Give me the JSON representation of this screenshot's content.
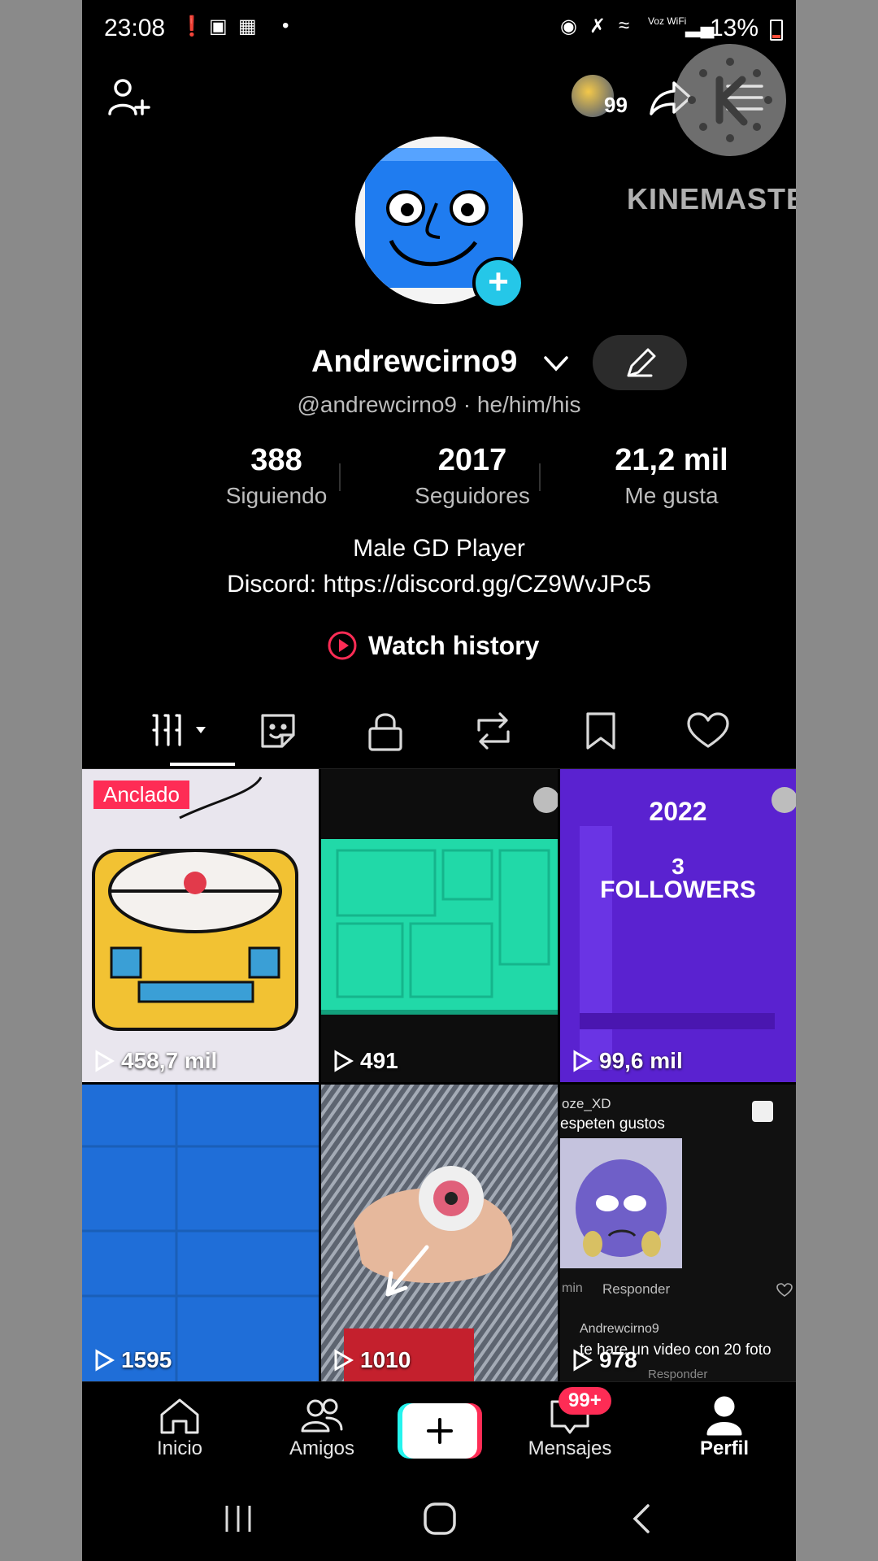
{
  "status_bar": {
    "time": "23:08",
    "battery": "13%",
    "wifi_label": "Voz WiFi"
  },
  "header": {
    "notif_count": "99"
  },
  "watermark": {
    "text": "KINEMASTER"
  },
  "profile": {
    "display_name": "Andrewcirno9",
    "handle": "@andrewcirno9 · he/him/his",
    "stats": [
      {
        "value": "388",
        "label": "Siguiendo"
      },
      {
        "value": "2017",
        "label": "Seguidores"
      },
      {
        "value": "21,2 mil",
        "label": "Me gusta"
      }
    ],
    "bio_line1": "Male GD Player",
    "bio_line2": "Discord: https://discord.gg/CZ9WvJPc5",
    "watch_history": "Watch history"
  },
  "tabs": [
    "videos-grid",
    "stickers",
    "private",
    "reposts",
    "favorites",
    "liked"
  ],
  "grid": {
    "pinned_label": "Anclado",
    "videos": [
      {
        "views": "458,7 mil"
      },
      {
        "views": "491"
      },
      {
        "views": "99,6 mil",
        "overlay_top": "2022",
        "overlay_mid": "3",
        "overlay_bottom": "FOLLOWERS"
      },
      {
        "views": "1595"
      },
      {
        "views": "1010"
      },
      {
        "views": "978",
        "c1_user": "oze_XD",
        "c1_text": "espeten gustos",
        "c1_time": "min",
        "c1_reply": "Responder",
        "c2_user": "Andrewcirno9",
        "c2_text": "te hare un video con 20 foto",
        "c2_reply": "Responder"
      }
    ]
  },
  "bottom_nav": {
    "home": "Inicio",
    "friends": "Amigos",
    "messages": "Mensajes",
    "messages_badge": "99+",
    "profile": "Perfil"
  },
  "colors": {
    "accent_red": "#fe2c55",
    "accent_cyan": "#25c7e8",
    "background": "#000000"
  }
}
